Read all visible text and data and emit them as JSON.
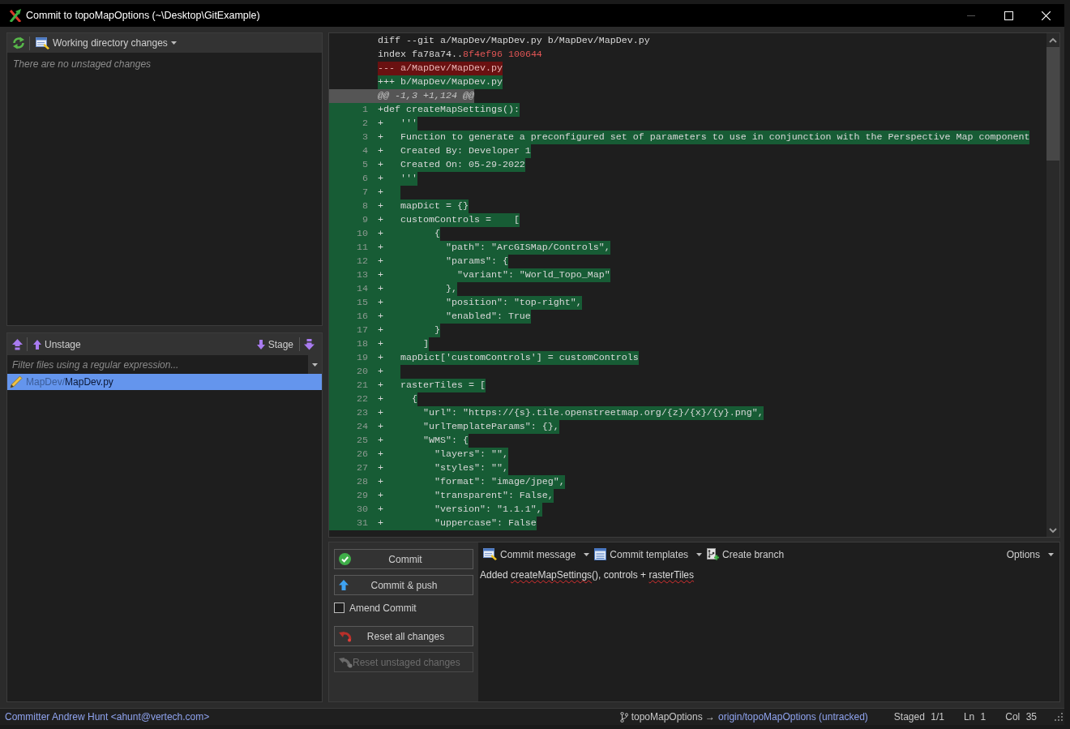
{
  "window": {
    "title": "Commit to topoMapOptions (~\\Desktop\\GitExample)"
  },
  "unstaged_panel": {
    "view_menu": "Working directory changes",
    "empty_message": "There are no unstaged changes"
  },
  "staged_panel": {
    "unstage_button": "Unstage",
    "stage_button": "Stage",
    "filter": {
      "placeholder": "Filter files using a regular expression..."
    },
    "files": [
      {
        "folder": "MapDev/",
        "name": "MapDev.py",
        "selected": true
      }
    ]
  },
  "diff": {
    "lines": [
      {
        "kind": "meta",
        "text": "diff --git a/MapDev/MapDev.py b/MapDev/MapDev.py"
      },
      {
        "kind": "index",
        "text": "index fa78a74..",
        "hash": "8f4ef96 100644"
      },
      {
        "kind": "removed",
        "text": "--- a/MapDev/MapDev.py"
      },
      {
        "kind": "added",
        "text": "+++ b/MapDev/MapDev.py"
      },
      {
        "kind": "hunk",
        "text": "@@ -1,3 +1,124 @@"
      },
      {
        "kind": "added",
        "number": "1",
        "text": "+def createMapSettings():"
      },
      {
        "kind": "added",
        "number": "2",
        "text": "+   '''"
      },
      {
        "kind": "added",
        "number": "3",
        "text": "+   Function to generate a preconfigured set of parameters to use in conjunction with the Perspective Map component"
      },
      {
        "kind": "added",
        "number": "4",
        "text": "+   Created By: Developer 1"
      },
      {
        "kind": "added",
        "number": "5",
        "text": "+   Created On: 05-29-2022"
      },
      {
        "kind": "added",
        "number": "6",
        "text": "+   '''"
      },
      {
        "kind": "added",
        "number": "7",
        "text": "+   "
      },
      {
        "kind": "added",
        "number": "8",
        "text": "+   mapDict = {}"
      },
      {
        "kind": "added",
        "number": "9",
        "text": "+   customControls =    ["
      },
      {
        "kind": "added",
        "number": "10",
        "text": "+         {"
      },
      {
        "kind": "added",
        "number": "11",
        "text": "+           \"path\": \"ArcGISMap/Controls\","
      },
      {
        "kind": "added",
        "number": "12",
        "text": "+           \"params\": {"
      },
      {
        "kind": "added",
        "number": "13",
        "text": "+             \"variant\": \"World_Topo_Map\""
      },
      {
        "kind": "added",
        "number": "14",
        "text": "+           },"
      },
      {
        "kind": "added",
        "number": "15",
        "text": "+           \"position\": \"top-right\","
      },
      {
        "kind": "added",
        "number": "16",
        "text": "+           \"enabled\": True"
      },
      {
        "kind": "added",
        "number": "17",
        "text": "+         }"
      },
      {
        "kind": "added",
        "number": "18",
        "text": "+       ]"
      },
      {
        "kind": "added",
        "number": "19",
        "text": "+   mapDict['customControls'] = customControls"
      },
      {
        "kind": "added",
        "number": "20",
        "text": "+   "
      },
      {
        "kind": "added",
        "number": "21",
        "text": "+   rasterTiles = ["
      },
      {
        "kind": "added",
        "number": "22",
        "text": "+     {"
      },
      {
        "kind": "added",
        "number": "23",
        "text": "+       \"url\": \"https://{s}.tile.openstreetmap.org/{z}/{x}/{y}.png\","
      },
      {
        "kind": "added",
        "number": "24",
        "text": "+       \"urlTemplateParams\": {},"
      },
      {
        "kind": "added",
        "number": "25",
        "text": "+       \"WMS\": {"
      },
      {
        "kind": "added",
        "number": "26",
        "text": "+         \"layers\": \"\","
      },
      {
        "kind": "added",
        "number": "27",
        "text": "+         \"styles\": \"\","
      },
      {
        "kind": "added",
        "number": "28",
        "text": "+         \"format\": \"image/jpeg\","
      },
      {
        "kind": "added",
        "number": "29",
        "text": "+         \"transparent\": False,"
      },
      {
        "kind": "added",
        "number": "30",
        "text": "+         \"version\": \"1.1.1\","
      },
      {
        "kind": "added",
        "number": "31",
        "text": "+         \"uppercase\": False"
      }
    ]
  },
  "commit_panel": {
    "actions": [
      {
        "kind": "commit",
        "label": "Commit",
        "disabled": false
      },
      {
        "kind": "push",
        "label": "Commit & push",
        "disabled": false
      },
      {
        "kind": "checkbox",
        "label": "Amend Commit",
        "checked": false
      },
      {
        "kind": "reset",
        "label": "Reset all changes",
        "disabled": false
      },
      {
        "kind": "reset_unstaged",
        "label": "Reset unstaged changes",
        "disabled": true
      }
    ],
    "toolbar": [
      {
        "kind": "message",
        "label": "Commit message",
        "dropdown": true
      },
      {
        "kind": "templates",
        "label": "Commit templates",
        "dropdown": true
      },
      {
        "kind": "branch",
        "label": "Create branch",
        "dropdown": false
      },
      {
        "kind": "options",
        "label": "Options",
        "dropdown": true
      }
    ],
    "message": [
      {
        "text": "Added ",
        "misspelled": false
      },
      {
        "text": "createMapSettings",
        "misspelled": true
      },
      {
        "text": "(), controls + ",
        "misspelled": false
      },
      {
        "text": "rasterTiles",
        "misspelled": true
      }
    ]
  },
  "status_bar": {
    "committer": "Committer Andrew Hunt <ahunt@vertech.com>",
    "branch": "topoMapOptions →",
    "remote": "origin/topoMapOptions (untracked)",
    "fields": [
      {
        "label": "Staged",
        "value": "1/1"
      },
      {
        "label": "Ln",
        "value": "1"
      },
      {
        "label": "Col",
        "value": "35"
      }
    ]
  }
}
